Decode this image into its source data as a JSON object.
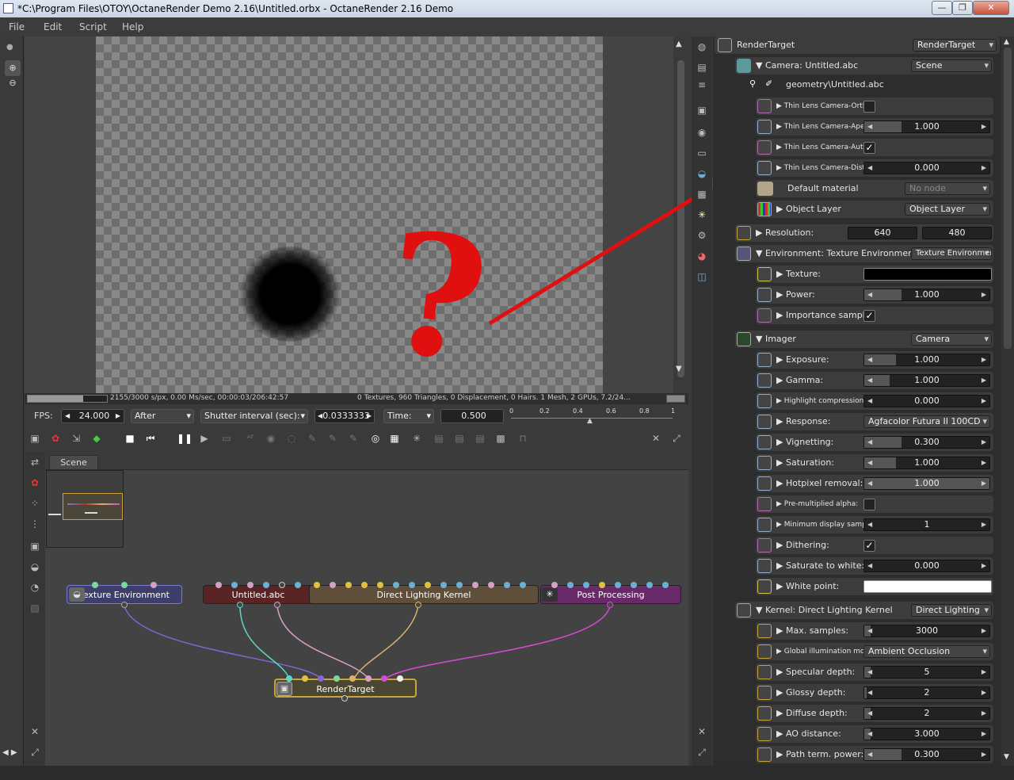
{
  "window": {
    "title": "*C:\\Program Files\\OTOY\\OctaneRender Demo 2.16\\Untitled.orbx - OctaneRender 2.16 Demo"
  },
  "menu": [
    "File",
    "Edit",
    "Script",
    "Help"
  ],
  "status": {
    "left": "2155/3000 s/px, 0.00 Ms/sec, 00:00:03/206:42:57",
    "right": "0 Textures, 960 Triangles, 0 Displacement, 0 Hairs. 1 Mesh, 2 GPUs, 7.2/24..."
  },
  "controls": {
    "fps_label": "FPS:",
    "fps": "24.000",
    "after": "After",
    "shutter_label": "Shutter interval (sec):",
    "shutter": "0.0333333",
    "time_label": "Time:",
    "time": "0.500",
    "ticks": [
      "0",
      "0.2",
      "0.4",
      "0.6",
      "0.8",
      "1"
    ]
  },
  "graph": {
    "tab": "Scene",
    "nodes": {
      "tex_env": "Texture Environment",
      "abc": "Untitled.abc",
      "kernel": "Direct Lighting Kernel",
      "post": "Post Processing",
      "rt": "RenderTarget"
    }
  },
  "annotation": {
    "question": "?"
  },
  "panel": {
    "header": {
      "label": "RenderTarget",
      "value": "RenderTarget"
    },
    "camera": {
      "label": "Camera: Untitled.abc",
      "value": "Scene",
      "geometry": "geometry\\Untitled.abc"
    },
    "cam_rows": [
      {
        "label": "Thin Lens Camera-Orth...",
        "kind": "check",
        "checked": false
      },
      {
        "label": "Thin Lens Camera-Aper...",
        "kind": "slider",
        "value": "1.000",
        "fill": 0.3
      },
      {
        "label": "Thin Lens Camera-Auto...",
        "kind": "check",
        "checked": true
      },
      {
        "label": "Thin Lens Camera-Disto...",
        "kind": "slider",
        "value": "0.000",
        "fill": 0
      }
    ],
    "default_material": {
      "label": "Default material",
      "value": "No node"
    },
    "object_layer": {
      "label": "Object Layer",
      "value": "Object Layer"
    },
    "resolution": {
      "label": "Resolution:",
      "w": "640",
      "h": "480"
    },
    "environment": {
      "label": "Environment: Texture Environment",
      "value": "Texture Environment"
    },
    "env_rows": [
      {
        "label": "Texture:",
        "kind": "color",
        "color": "#000000"
      },
      {
        "label": "Power:",
        "kind": "slider",
        "value": "1.000",
        "fill": 0.3
      },
      {
        "label": "Importance sampling:",
        "kind": "check",
        "checked": true
      }
    ],
    "imager": {
      "label": "Imager",
      "value": "Camera"
    },
    "imager_rows": [
      {
        "label": "Exposure:",
        "kind": "slider",
        "value": "1.000",
        "fill": 0.25
      },
      {
        "label": "Gamma:",
        "kind": "slider",
        "value": "1.000",
        "fill": 0.2
      },
      {
        "label": "Highlight compression:",
        "kind": "slider",
        "value": "0.000",
        "fill": 0
      },
      {
        "label": "Response:",
        "kind": "dropdown",
        "value": "Agfacolor Futura II 100CD"
      },
      {
        "label": "Vignetting:",
        "kind": "slider",
        "value": "0.300",
        "fill": 0.3
      },
      {
        "label": "Saturation:",
        "kind": "slider",
        "value": "1.000",
        "fill": 0.25
      },
      {
        "label": "Hotpixel removal:",
        "kind": "slider",
        "value": "1.000",
        "fill": 1
      },
      {
        "label": "Pre-multiplied alpha:",
        "kind": "check",
        "checked": false
      },
      {
        "label": "Minimum display samples:",
        "kind": "slider",
        "value": "1",
        "fill": 0
      },
      {
        "label": "Dithering:",
        "kind": "check",
        "checked": true
      },
      {
        "label": "Saturate to white:",
        "kind": "slider",
        "value": "0.000",
        "fill": 0
      },
      {
        "label": "White point:",
        "kind": "color",
        "color": "#ffffff"
      }
    ],
    "kernel": {
      "label": "Kernel: Direct Lighting Kernel",
      "value": "Direct Lighting"
    },
    "kernel_rows": [
      {
        "label": "Max. samples:",
        "kind": "slider",
        "value": "3000",
        "fill": 0.05
      },
      {
        "label": "Global illumination mode:",
        "kind": "dropdown",
        "value": "Ambient Occlusion"
      },
      {
        "label": "Specular depth:",
        "kind": "slider",
        "value": "5",
        "fill": 0.05
      },
      {
        "label": "Glossy depth:",
        "kind": "slider",
        "value": "2",
        "fill": 0.02
      },
      {
        "label": "Diffuse depth:",
        "kind": "slider",
        "value": "2",
        "fill": 0.05
      },
      {
        "label": "AO distance:",
        "kind": "slider",
        "value": "3.000",
        "fill": 0.05
      },
      {
        "label": "Path term. power:",
        "kind": "slider",
        "value": "0.300",
        "fill": 0.3
      }
    ]
  }
}
